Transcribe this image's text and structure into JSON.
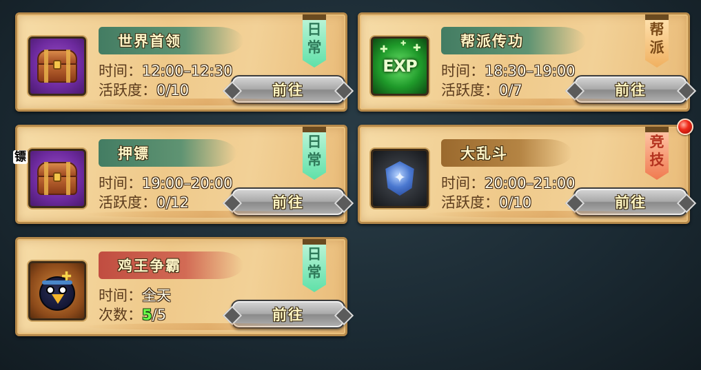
{
  "activities": [
    {
      "title": "世界首领",
      "line1_label": "时间：",
      "line1_value": "12:00–12:30",
      "line2_label": "活跃度：",
      "line2_value": "0/10",
      "button_label": "前往",
      "tag_chars": [
        "日",
        "常"
      ],
      "icon": "treasure-chest-icon",
      "colors": {
        "title": "#3a7860",
        "tag": "#5fe0a8",
        "icon_bg": "#6d2a9e"
      }
    },
    {
      "title": "帮派传功",
      "line1_label": "时间：",
      "line1_value": "18:30–19:00",
      "line2_label": "活跃度：",
      "line2_value": "0/7",
      "button_label": "前往",
      "tag_chars": [
        "帮",
        "派"
      ],
      "icon": "exp-icon",
      "icon_text": "EXP",
      "colors": {
        "title": "#3a7860",
        "tag": "#f0b060",
        "icon_bg": "#1f9a2a"
      }
    },
    {
      "title": "押镖",
      "badge": "镖",
      "line1_label": "时间：",
      "line1_value": "19:00–20:00",
      "line2_label": "活跃度：",
      "line2_value": "0/12",
      "button_label": "前往",
      "tag_chars": [
        "日",
        "常"
      ],
      "icon": "treasure-chest-icon",
      "colors": {
        "title": "#3a7860",
        "tag": "#5fe0a8",
        "icon_bg": "#6d2a9e"
      }
    },
    {
      "title": "大乱斗",
      "line1_label": "时间：",
      "line1_value": "20:00–21:00",
      "line2_label": "活跃度：",
      "line2_value": "0/10",
      "button_label": "前往",
      "tag_chars": [
        "竞",
        "技"
      ],
      "icon": "blue-gem-icon",
      "notification": true,
      "colors": {
        "title": "#966428",
        "tag": "#f07a50",
        "icon_bg": "#25282d"
      }
    },
    {
      "title": "鸡王争霸",
      "line1_label": "时间：",
      "line1_value": "全天",
      "line2_label": "次数：",
      "line2_value_done": "5",
      "line2_value_total": "/5",
      "button_label": "前往",
      "tag_chars": [
        "日",
        "常"
      ],
      "icon": "ninja-bird-icon",
      "colors": {
        "title": "#be463c",
        "tag": "#5fe0a8",
        "icon_bg": "#8c4a1a"
      }
    }
  ]
}
